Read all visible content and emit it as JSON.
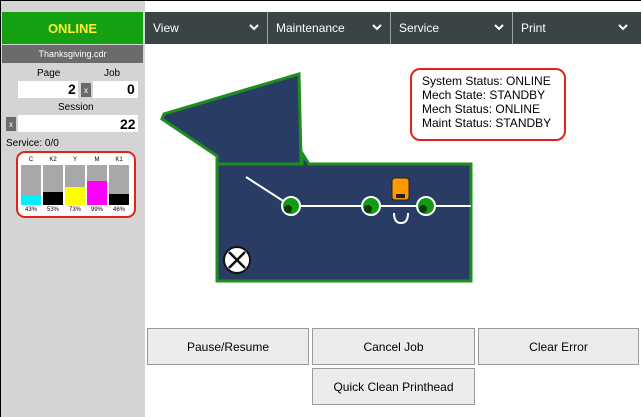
{
  "status": {
    "label": "ONLINE",
    "filename": "Thanksgiving.cdr"
  },
  "counters": {
    "page_label": "Page",
    "job_label": "Job",
    "page_value": "2",
    "job_value": "0",
    "session_label": "Session",
    "session_value": "22",
    "reset_label": "x",
    "service_label": "Service:",
    "service_value": "0/0"
  },
  "inks": [
    {
      "name": "C",
      "percent_label": "43%",
      "color": "#00f0ff",
      "level": 0.43
    },
    {
      "name": "K2",
      "percent_label": "53%",
      "color": "#000000",
      "level": 0.53
    },
    {
      "name": "Y",
      "percent_label": "73%",
      "color": "#ffff00",
      "level": 0.73
    },
    {
      "name": "M",
      "percent_label": "99%",
      "color": "#ff00ff",
      "level": 0.99
    },
    {
      "name": "K1",
      "percent_label": "46%",
      "color": "#000000",
      "level": 0.46
    }
  ],
  "menu": [
    {
      "label": "View"
    },
    {
      "label": "Maintenance"
    },
    {
      "label": "Service"
    },
    {
      "label": "Print"
    }
  ],
  "system_status": {
    "line1": "System Status: ONLINE",
    "line2": "Mech State: STANDBY",
    "line3": "Mech Status: ONLINE",
    "line4": "Maint Status: STANDBY"
  },
  "buttons": {
    "pause": "Pause/Resume",
    "cancel": "Cancel Job",
    "clear": "Clear Error",
    "clean": "Quick Clean Printhead"
  },
  "colors": {
    "online_green": "#13a013",
    "online_text": "#ffee33",
    "menu_bg": "#3a4446",
    "printer_body": "#283c64",
    "printer_outline": "#1e8f1e",
    "highlight_red": "#e2231a",
    "ink_cartridge": "#ff9900"
  }
}
